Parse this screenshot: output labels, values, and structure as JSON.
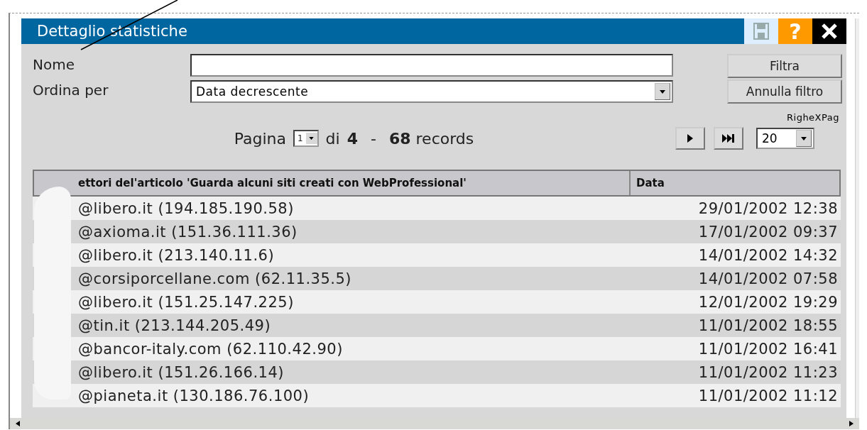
{
  "window": {
    "title": "Dettaglio statistiche",
    "help_button": "?"
  },
  "filter": {
    "name_label": "Nome",
    "sort_label": "Ordina per",
    "sort_value": "Data decrescente"
  },
  "buttons": [
    "Filtra",
    "Annulla filtro"
  ],
  "pagination": {
    "label": "Pagina",
    "page": "1",
    "of_label": "di",
    "total_pages": "4",
    "separator": "-",
    "records": "**68** records",
    "rows_per_page_label": "RigheXPag",
    "rows_per_page": "20"
  },
  "table": {
    "columns": [
      "ettori del'articolo 'Guarda alcuni siti creati con WebProfessional'",
      "Data"
    ],
    "rows": [
      {
        "visitor": "@libero.it (194.185.190.58)",
        "date": "29/01/2002 12:38"
      },
      {
        "visitor": "@axioma.it (151.36.111.36)",
        "date": "17/01/2002 09:37"
      },
      {
        "visitor": "@libero.it (213.140.11.6)",
        "date": "14/01/2002 14:32"
      },
      {
        "visitor": "@corsiporcellane.com (62.11.35.5)",
        "date": "14/01/2002 07:58"
      },
      {
        "visitor": "@libero.it (151.25.147.225)",
        "date": "12/01/2002 19:29"
      },
      {
        "visitor": "@tin.it (213.144.205.49)",
        "date": "11/01/2002 18:55"
      },
      {
        "visitor": "@bancor-italy.com (62.110.42.90)",
        "date": "11/01/2002 16:41"
      },
      {
        "visitor": "@libero.it (151.26.166.14)",
        "date": "11/01/2002 11:23"
      },
      {
        "visitor": "@pianeta.it (130.186.76.100)",
        "date": "11/01/2002 11:12"
      }
    ]
  }
}
